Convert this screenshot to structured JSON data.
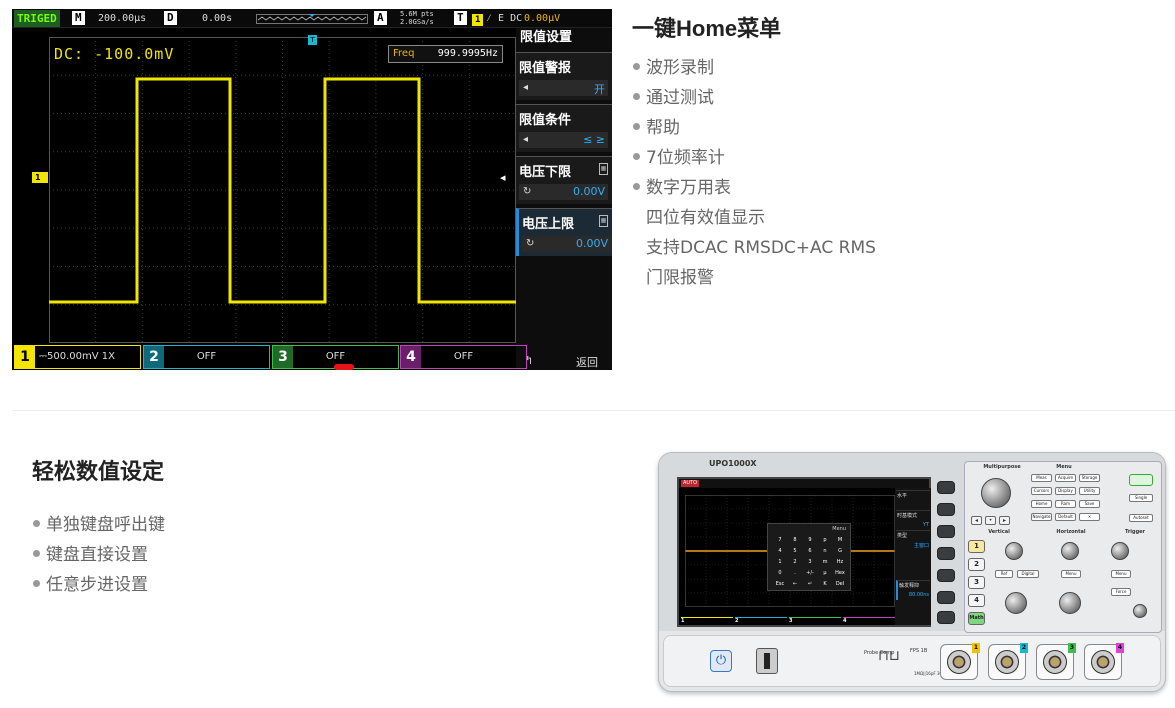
{
  "scope_screen": {
    "trigger_status": "TRIGED",
    "mode_badge": "M",
    "timebase": "200.00μs",
    "delay_badge": "D",
    "delay": "0.00s",
    "acq_badge": "A",
    "memory_depth": "5.6M pts",
    "sample_rate": "2.0GSa/s",
    "trigger_badge": "T",
    "trigger_source": "1",
    "trigger_info": "⁄ E DC",
    "trigger_level": "0.00μV",
    "trigger_pointer": "T",
    "dc_reading": "DC: -100.0mV",
    "freq_label": "Freq",
    "freq_value": "999.9995Hz",
    "ch1_marker": "1",
    "menu": {
      "title": "限值设置",
      "items": [
        {
          "label": "限值警报",
          "value": "开"
        },
        {
          "label": "限值条件",
          "value": "≤ ≥"
        },
        {
          "label": "电压下限",
          "value": "0.00V"
        },
        {
          "label": "电压上限",
          "value": "0.00V"
        }
      ],
      "return_label": "返回",
      "return_icon": "↰"
    },
    "channels": [
      {
        "num": "1",
        "info": "500.00mV 1X",
        "coupling_icon": "⎓"
      },
      {
        "num": "2",
        "info": "OFF"
      },
      {
        "num": "3",
        "info": "OFF"
      },
      {
        "num": "4",
        "info": "OFF"
      }
    ],
    "colors": {
      "ch1": "#f2e600",
      "ch2": "#19b8d0",
      "ch3": "#3cc04c",
      "ch4": "#c040c0",
      "menu_accent": "#2ab0ff"
    }
  },
  "section_home": {
    "title": "一键Home菜单",
    "bullets": [
      "波形录制",
      "通过测试",
      "帮助",
      "7位频率计",
      "数字万用表"
    ],
    "plain": [
      "四位有效值显示",
      "支持DCAC RMSDC+AC RMS",
      "门限报警"
    ]
  },
  "section_numeric": {
    "title": "轻松数值设定",
    "bullets": [
      "单独键盘呼出键",
      "键盘直接设置",
      "任意步进设置"
    ]
  },
  "device": {
    "model": "UPO1000X",
    "screen_auto": "AUTO",
    "screen_menu": [
      {
        "label": "水平",
        "value": ""
      },
      {
        "label": "时基模式",
        "value": "YT"
      },
      {
        "label": "类型",
        "value": "主窗口"
      },
      {
        "label": "触发释抑",
        "value": "80.00ns"
      }
    ],
    "keypad_menu": "Menu",
    "keypad_keys": [
      "7",
      "8",
      "9",
      "p",
      "M",
      "4",
      "5",
      "6",
      "n",
      "G",
      "1",
      "2",
      "3",
      "m",
      "Hz",
      "0",
      ".",
      "+/-",
      "μ",
      "Hex",
      "Esc",
      "←",
      "↵",
      "K",
      "Del"
    ],
    "screen_channels": [
      "1",
      "2",
      "3",
      "4"
    ],
    "panel_heads": {
      "multipurpose": "Multipurpose",
      "menu": "Menu",
      "vertical": "Vertical",
      "horizontal": "Horizontal",
      "trigger": "Trigger"
    },
    "menu_buttons": [
      "Meas",
      "Acquire",
      "Storage",
      "Cursors",
      "Display",
      "Utility",
      "Home",
      "Ram",
      "Save",
      "Navigate",
      "Default",
      "✕"
    ],
    "right_buttons": [
      "Single",
      "Autoset"
    ],
    "vertical_keys": [
      "1",
      "2",
      "3",
      "4",
      "Math"
    ],
    "vertical_buttons": [
      "Ref",
      "Digital"
    ],
    "horizontal_buttons": [
      "Menu"
    ],
    "trigger_buttons": [
      "Menu",
      "Force"
    ],
    "probe_comp": "Probe Comp",
    "fps_label": "FPS 1B",
    "bnc_tags": [
      "1",
      "2",
      "3",
      "4"
    ],
    "warn_label": "1MΩ||16pF 300Vrms",
    "power_icon": "⏻"
  }
}
